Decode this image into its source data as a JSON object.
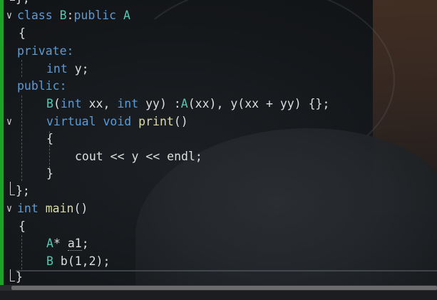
{
  "code": {
    "line_top_partial": "};",
    "line1": {
      "kw": "class",
      "name": "B",
      "colon": ":",
      "kw2": "public",
      "base": "A"
    },
    "line2": "{",
    "line3": "private:",
    "line4": {
      "type": "int",
      "rest": " y;"
    },
    "line5": "public:",
    "line6": {
      "fn": "B",
      "p1": "(",
      "t1": "int",
      "a1": " xx, ",
      "t2": "int",
      "a2": " yy) :",
      "base": "A",
      "a3": "(xx), ",
      "m": "y",
      "a4": "(xx + yy) {};"
    },
    "line7": {
      "kw1": "virtual",
      "kw2": "void",
      "fn": "print",
      "rest": "()"
    },
    "line8": "{",
    "line9": {
      "p1": "cout << y << endl;"
    },
    "line10": "}",
    "line11": "};",
    "line12": {
      "type": "int",
      "fn": "main",
      "rest": "()"
    },
    "line13": "{",
    "line14": {
      "type": "A",
      "star": "*",
      "var": "a1",
      "rest": ";"
    },
    "line15": {
      "type": "B",
      "fn": "b",
      "rest": "(1,2);"
    },
    "line16": "}"
  },
  "colors": {
    "keyword": "#5c9bd6",
    "type": "#58c6b0",
    "function": "#dcdcaa",
    "plain": "#dedede",
    "change_bar": "#1fa12a"
  },
  "icons": [
    "fold-chevron-icon",
    "fold-bracket-icon"
  ]
}
